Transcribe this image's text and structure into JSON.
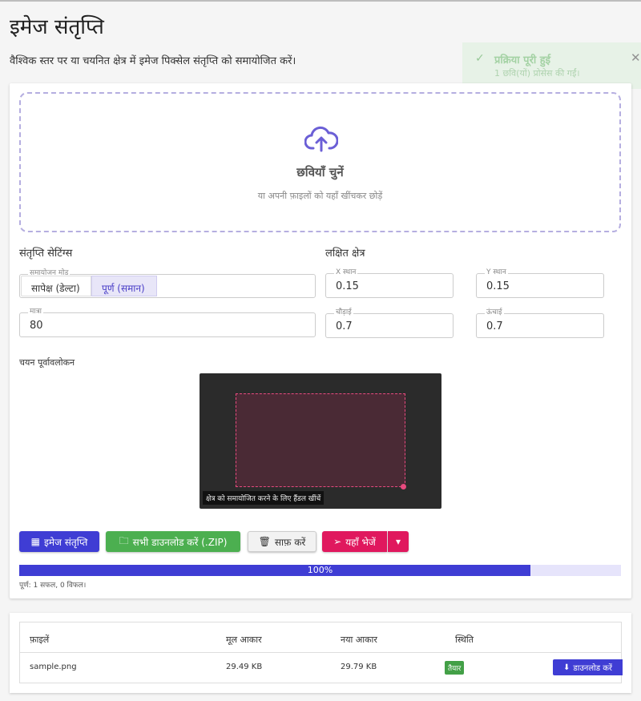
{
  "page": {
    "title": "इमेज संतृप्ति",
    "subtitle": "वैश्विक स्तर पर या चयनित क्षेत्र में इमेज पिक्सेल संतृप्ति को समायोजित करें।"
  },
  "toast": {
    "title": "प्रक्रिया पूरी हुई",
    "message": "1 छवि(यों) प्रोसेस की गईं।",
    "close": "✕",
    "check": "✓"
  },
  "dropzone": {
    "title": "छवियाँ चुनें",
    "hint": "या अपनी फ़ाइलों को यहाँ खींचकर छोड़ें"
  },
  "settings": {
    "title": "संतृप्ति सेटिंग्स",
    "mode_label": "समायोजन मोड",
    "mode_options": [
      "सापेक्ष (डेल्टा)",
      "पूर्ण (समान)"
    ],
    "mode_selected": "पूर्ण (समान)",
    "amount_label": "मात्रा",
    "amount_value": "80"
  },
  "region": {
    "title": "लक्षित क्षेत्र",
    "x_label": "X स्थान",
    "x_value": "0.15",
    "y_label": "Y स्थान",
    "y_value": "0.15",
    "width_label": "चौड़ाई",
    "width_value": "0.7",
    "height_label": "ऊंचाई",
    "height_value": "0.7"
  },
  "preview": {
    "title": "चयन पूर्वावलोकन",
    "hint": "क्षेत्र को समायोजित करने के लिए हैंडल खींचें"
  },
  "actions": {
    "saturate": "इमेज संतृप्ति",
    "download_zip": "सभी डाउनलोड करें (.ZIP)",
    "clear": "साफ़ करें",
    "send": "यहाँ भेजें"
  },
  "progress": {
    "value": 0.85,
    "text": "100%",
    "status": "पूर्ण: 1 सफल, 0 विफल।"
  },
  "table": {
    "headers": [
      "फ़ाइलें",
      "मूल आकार",
      "नया आकार",
      "स्थिति"
    ],
    "rows": [
      {
        "file": "sample.png",
        "original": "29.49 KB",
        "new": "29.79 KB",
        "status": "तैयार",
        "action": "डाउनलोड करें"
      }
    ]
  },
  "colors": {
    "primary": "#3f3dd4",
    "success": "#4caf50",
    "accent": "#e0185e"
  }
}
